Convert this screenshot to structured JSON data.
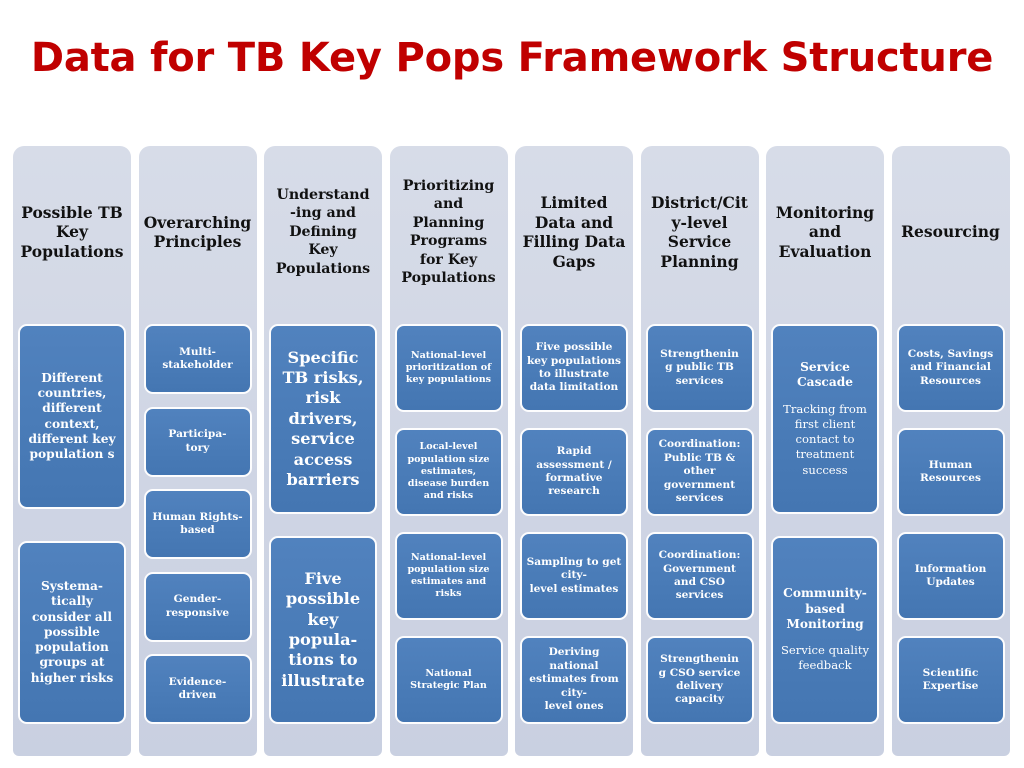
{
  "slide": {
    "title": "Data for TB Key Pops Framework Structure",
    "title_color": "#C00000",
    "background_color": "#FFFFFF",
    "column_color": "#D3D9E6",
    "card_color": "#4A7CB8",
    "card_border_color": "#FFFFFF",
    "card_text_color": "#FFFFFF",
    "header_text_color": "#111111"
  },
  "columns": [
    {
      "header": "Possible TB\nKey\nPopulations",
      "cards": [
        {
          "title": "Different countries, different context, different key population s"
        },
        {
          "title": "Systema-\ntically consider all possible population groups at higher risks"
        }
      ]
    },
    {
      "header": "Overarching\nPrinciples",
      "cards": [
        {
          "title": "Multi-\nstakeholder"
        },
        {
          "title": "Participa-\ntory"
        },
        {
          "title": "Human Rights-\nbased"
        },
        {
          "title": "Gender-\nresponsive"
        },
        {
          "title": "Evidence-\ndriven"
        }
      ]
    },
    {
      "header": "Understand\n-ing and\nDefining\nKey\nPopulations",
      "cards": [
        {
          "title": "Specific TB risks, risk drivers, service access barriers"
        },
        {
          "title": "Five possible key popula-\ntions to illustrate"
        }
      ]
    },
    {
      "header": "Prioritizing\nand\nPlanning\nPrograms\nfor Key\nPopulations",
      "cards": [
        {
          "title": "National-level prioritization of key populations"
        },
        {
          "title": "Local-level population size estimates, disease burden and risks"
        },
        {
          "title": "National-level population size estimates and risks"
        },
        {
          "title": "National Strategic Plan"
        }
      ]
    },
    {
      "header": "Limited\nData and\nFilling Data\nGaps",
      "cards": [
        {
          "title": "Five possible key populations to illustrate data limitation"
        },
        {
          "title": "Rapid assessment / formative research"
        },
        {
          "title": "Sampling to get city-\nlevel estimates"
        },
        {
          "title": "Deriving national estimates from city-\nlevel ones"
        }
      ]
    },
    {
      "header": "District/Cit\ny-level\nService\nPlanning",
      "cards": [
        {
          "title": "Strengthenin\ng public TB services"
        },
        {
          "title": "Coordination: Public TB & other government services"
        },
        {
          "title": "Coordination: Government and CSO services"
        },
        {
          "title": "Strengthenin\ng CSO service delivery capacity"
        }
      ]
    },
    {
      "header": "Monitoring\nand\nEvaluation",
      "cards": [
        {
          "title": "Service Cascade",
          "sub": "Tracking from first client contact to treatment success"
        },
        {
          "title": "Community-\nbased Monitoring",
          "sub": "Service quality feedback"
        }
      ]
    },
    {
      "header": "Resourcing",
      "cards": [
        {
          "title": "Costs, Savings and Financial Resources"
        },
        {
          "title": "Human Resources"
        },
        {
          "title": "Information Updates"
        },
        {
          "title": "Scientific Expertise"
        }
      ]
    }
  ]
}
